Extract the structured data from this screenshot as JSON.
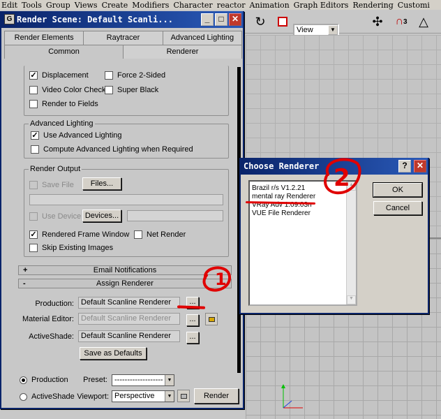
{
  "menubar": [
    "Edit",
    "Tools",
    "Group",
    "Views",
    "Create",
    "Modifiers",
    "Character",
    "reactor",
    "Animation",
    "Graph Editors",
    "Rendering",
    "Customi"
  ],
  "toolbar": {
    "view_label": "View",
    "badge": "3"
  },
  "render_scene": {
    "title": "Render Scene: Default Scanli...",
    "tabs_row1": [
      "Render Elements",
      "Raytracer",
      "Advanced Lighting"
    ],
    "tabs_row2": [
      "Common",
      "Renderer"
    ],
    "options": {
      "displacement": "Displacement",
      "force_two_sided": "Force 2-Sided",
      "video_color_check": "Video Color Check",
      "super_black": "Super Black",
      "render_to_fields": "Render to Fields"
    },
    "advanced_lighting": {
      "legend": "Advanced Lighting",
      "use": "Use Advanced Lighting",
      "compute": "Compute Advanced Lighting when Required"
    },
    "render_output": {
      "legend": "Render Output",
      "save_file": "Save File",
      "files_btn": "Files...",
      "use_device": "Use Device",
      "devices_btn": "Devices...",
      "rendered_frame_window": "Rendered Frame Window",
      "net_render": "Net Render",
      "skip_existing": "Skip Existing Images"
    },
    "email": {
      "sign": "+",
      "label": "Email Notifications"
    },
    "assign": {
      "sign": "-",
      "label": "Assign Renderer",
      "production_label": "Production:",
      "production_value": "Default Scanline Renderer",
      "material_label": "Material Editor:",
      "material_value": "Default Scanline Renderer",
      "activeshade_label": "ActiveShade:",
      "activeshade_value": "Default Scanline Renderer",
      "browse": "...",
      "save_defaults": "Save as Defaults"
    },
    "footer": {
      "production": "Production",
      "activeshade": "ActiveShade",
      "preset_label": "Preset:",
      "preset_value": "-------------------",
      "viewport_label": "Viewport:",
      "viewport_value": "Perspective",
      "render_btn": "Render"
    }
  },
  "choose_renderer": {
    "title": "Choose Renderer",
    "items": [
      "Brazil r/s V1.2.21",
      "mental ray Renderer",
      "VRay Adv 1.09.03n",
      "VUE File Renderer"
    ],
    "ok": "OK",
    "cancel": "Cancel"
  },
  "annotations": {
    "one": "1",
    "two": "2"
  },
  "colors": {
    "title_start": "#0a246a",
    "title_end": "#2a5ab8",
    "annotation": "#e00000"
  }
}
